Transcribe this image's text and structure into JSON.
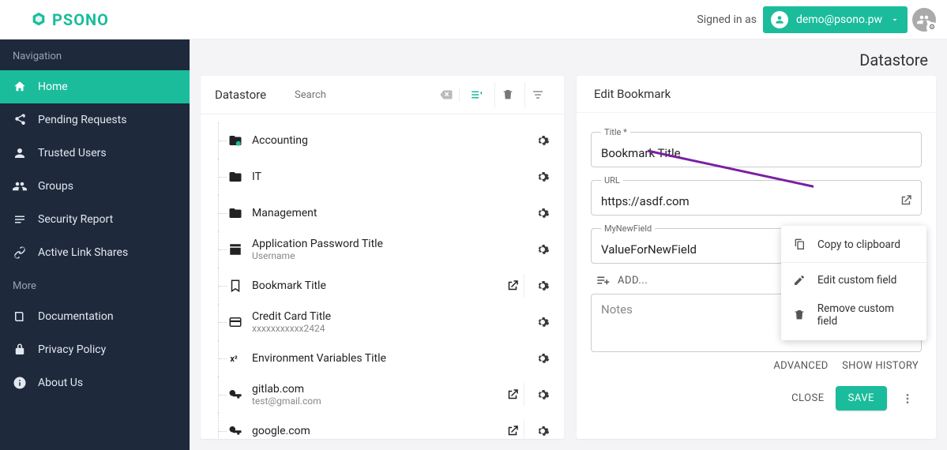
{
  "brand": "PSONO",
  "header": {
    "signed_in_prefix": "Signed in as",
    "user_email": "demo@psono.pw"
  },
  "page_title": "Datastore",
  "sidebar": {
    "section1_label": "Navigation",
    "section2_label": "More",
    "items": [
      {
        "label": "Home"
      },
      {
        "label": "Pending Requests"
      },
      {
        "label": "Trusted Users"
      },
      {
        "label": "Groups"
      },
      {
        "label": "Security Report"
      },
      {
        "label": "Active Link Shares"
      }
    ],
    "more": [
      {
        "label": "Documentation"
      },
      {
        "label": "Privacy Policy"
      },
      {
        "label": "About Us"
      }
    ]
  },
  "datastore": {
    "panel_title": "Datastore",
    "search_placeholder": "Search",
    "rows": [
      {
        "title": "Accounting",
        "sub": "",
        "type": "folder-shared",
        "openable": false
      },
      {
        "title": "IT",
        "sub": "",
        "type": "folder",
        "openable": false
      },
      {
        "title": "Management",
        "sub": "",
        "type": "folder",
        "openable": false
      },
      {
        "title": "Application Password Title",
        "sub": "Username",
        "type": "app",
        "openable": false
      },
      {
        "title": "Bookmark Title",
        "sub": "",
        "type": "bookmark",
        "openable": true
      },
      {
        "title": "Credit Card Title",
        "sub": "xxxxxxxxxxx2424",
        "type": "card",
        "openable": false
      },
      {
        "title": "Environment Variables Title",
        "sub": "",
        "type": "env",
        "openable": false
      },
      {
        "title": "gitlab.com",
        "sub": "test@gmail.com",
        "type": "key",
        "openable": true
      },
      {
        "title": "google.com",
        "sub": "",
        "type": "key",
        "openable": true
      }
    ]
  },
  "editor": {
    "panel_title": "Edit Bookmark",
    "title_label": "Title *",
    "title_value": "Bookmark Title",
    "url_label": "URL",
    "url_value": "https://asdf.com",
    "custom_label": "MyNewField",
    "custom_value": "ValueForNewField",
    "add_label": "ADD...",
    "notes_placeholder": "Notes",
    "advanced_label": "ADVANCED",
    "history_label": "SHOW HISTORY",
    "close_label": "CLOSE",
    "save_label": "SAVE"
  },
  "context_menu": {
    "copy": "Copy to clipboard",
    "edit": "Edit custom field",
    "remove": "Remove custom field"
  }
}
